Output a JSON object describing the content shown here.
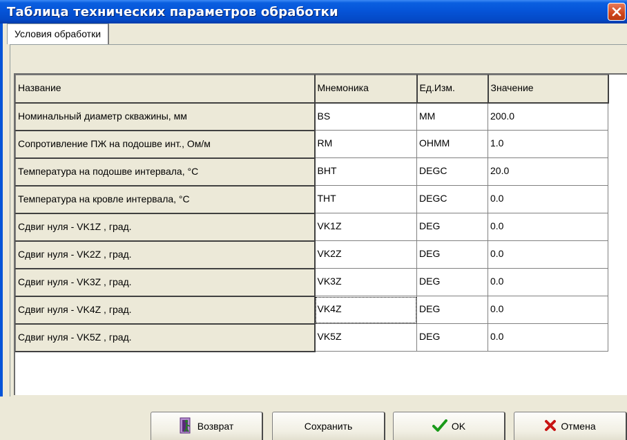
{
  "window": {
    "title": "Таблица технических параметров обработки"
  },
  "tabs": [
    {
      "label": "Условия обработки",
      "selected": true
    }
  ],
  "table": {
    "columns": [
      "Название",
      "Мнемоника",
      "Ед.Изм.",
      "Значение"
    ],
    "rows": [
      {
        "name": "Номинальный диаметр скважины, мм",
        "mnemonic": "BS",
        "unit": "MM",
        "value": "200.0"
      },
      {
        "name": "Сопротивление ПЖ на подошве инт., Ом/м",
        "mnemonic": "RM",
        "unit": "OHMM",
        "value": "1.0"
      },
      {
        "name": "Температура на подошве интервала, °С",
        "mnemonic": "BHT",
        "unit": "DEGC",
        "value": "20.0"
      },
      {
        "name": "Температура на кровле интервала, °С",
        "mnemonic": "THT",
        "unit": "DEGC",
        "value": "0.0"
      },
      {
        "name": "Сдвиг нуля - VK1Z , град.",
        "mnemonic": "VK1Z",
        "unit": "DEG",
        "value": "0.0"
      },
      {
        "name": "Сдвиг нуля - VK2Z , град.",
        "mnemonic": "VK2Z",
        "unit": "DEG",
        "value": "0.0"
      },
      {
        "name": "Сдвиг нуля - VK3Z , град.",
        "mnemonic": "VK3Z",
        "unit": "DEG",
        "value": "0.0"
      },
      {
        "name": "Сдвиг нуля - VK4Z , град.",
        "mnemonic": "VK4Z",
        "unit": "DEG",
        "value": "0.0"
      },
      {
        "name": "Сдвиг нуля - VK5Z , град.",
        "mnemonic": "VK5Z",
        "unit": "DEG",
        "value": "0.0"
      }
    ]
  },
  "buttons": {
    "return_label": "Возврат",
    "save_label": "Сохранить",
    "ok_label": "OK",
    "cancel_label": "Отмена"
  },
  "icons": {
    "close": "close-icon",
    "return": "door-exit-icon",
    "ok": "checkmark-icon",
    "cancel": "x-mark-icon"
  },
  "colors": {
    "titlebar": "#0554d8",
    "face": "#ece9d8",
    "ok_check": "#1a9a1a",
    "cancel_x": "#c81414"
  }
}
